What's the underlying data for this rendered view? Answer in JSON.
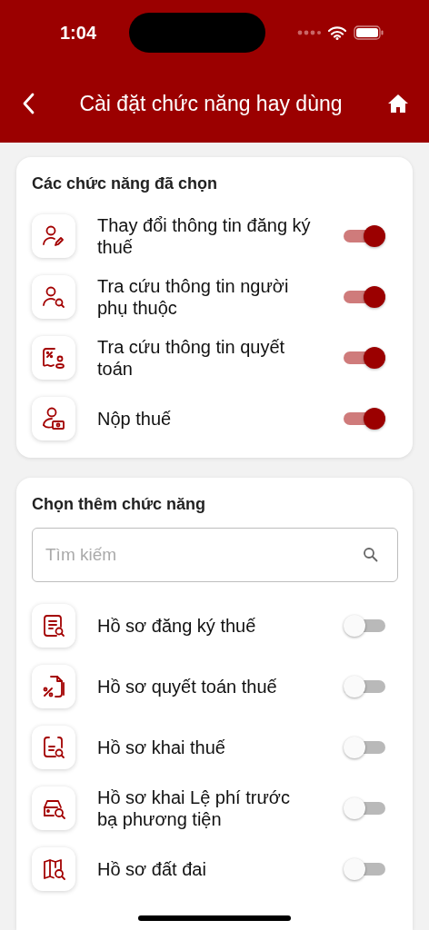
{
  "status_bar": {
    "time": "1:04"
  },
  "header": {
    "title": "Cài đặt chức năng hay dùng"
  },
  "selected_section": {
    "title": "Các chức năng đã chọn",
    "items": [
      {
        "label": "Thay đổi thông tin đăng ký thuế",
        "on": true
      },
      {
        "label": "Tra cứu thông tin người phụ thuộc",
        "on": true
      },
      {
        "label": "Tra cứu thông tin quyết toán",
        "on": true
      },
      {
        "label": "Nộp thuế",
        "on": true
      }
    ]
  },
  "add_section": {
    "title": "Chọn thêm chức năng",
    "search": {
      "placeholder": "Tìm kiếm"
    },
    "items": [
      {
        "label": "Hồ sơ đăng ký thuế",
        "on": false
      },
      {
        "label": "Hồ sơ quyết toán thuế",
        "on": false
      },
      {
        "label": "Hồ sơ khai thuế",
        "on": false
      },
      {
        "label": "Hồ sơ khai Lệ phí trước bạ phương tiện",
        "on": false
      },
      {
        "label": "Hồ sơ đất đai",
        "on": false
      }
    ]
  }
}
